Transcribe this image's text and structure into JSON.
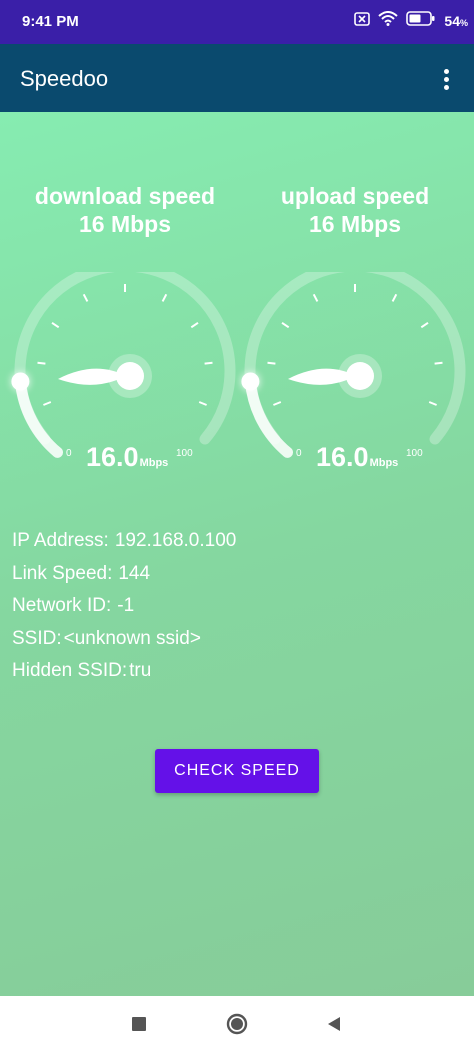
{
  "status_bar": {
    "time": "9:41 PM",
    "battery": "54",
    "battery_suffix": "%",
    "icons": [
      "notification-off-icon",
      "wifi-icon",
      "battery-icon"
    ]
  },
  "app_bar": {
    "title": "Speedoo",
    "menu_icon": "more-vert-icon"
  },
  "gauges": {
    "download": {
      "title": "download speed",
      "subtitle": "16 Mbps",
      "value": "16.0",
      "unit": "Mbps",
      "min": "0",
      "max": "100",
      "level": 16
    },
    "upload": {
      "title": "upload speed",
      "subtitle": "16 Mbps",
      "value": "16.0",
      "unit": "Mbps",
      "min": "0",
      "max": "100",
      "level": 16
    }
  },
  "info": {
    "ip_label": "IP Address:",
    "ip_value": "192.168.0.100",
    "link_label": "Link Speed:",
    "link_value": "144",
    "network_label": "Network ID:",
    "network_value": "-1",
    "ssid_label": "SSID:",
    "ssid_value": "<unknown ssid>",
    "hidden_label": "Hidden SSID:",
    "hidden_value": "tru"
  },
  "actions": {
    "check_speed": "CHECK SPEED"
  },
  "nav_bar": {
    "icons": [
      "recents-square-icon",
      "home-circle-icon",
      "back-triangle-icon"
    ]
  }
}
